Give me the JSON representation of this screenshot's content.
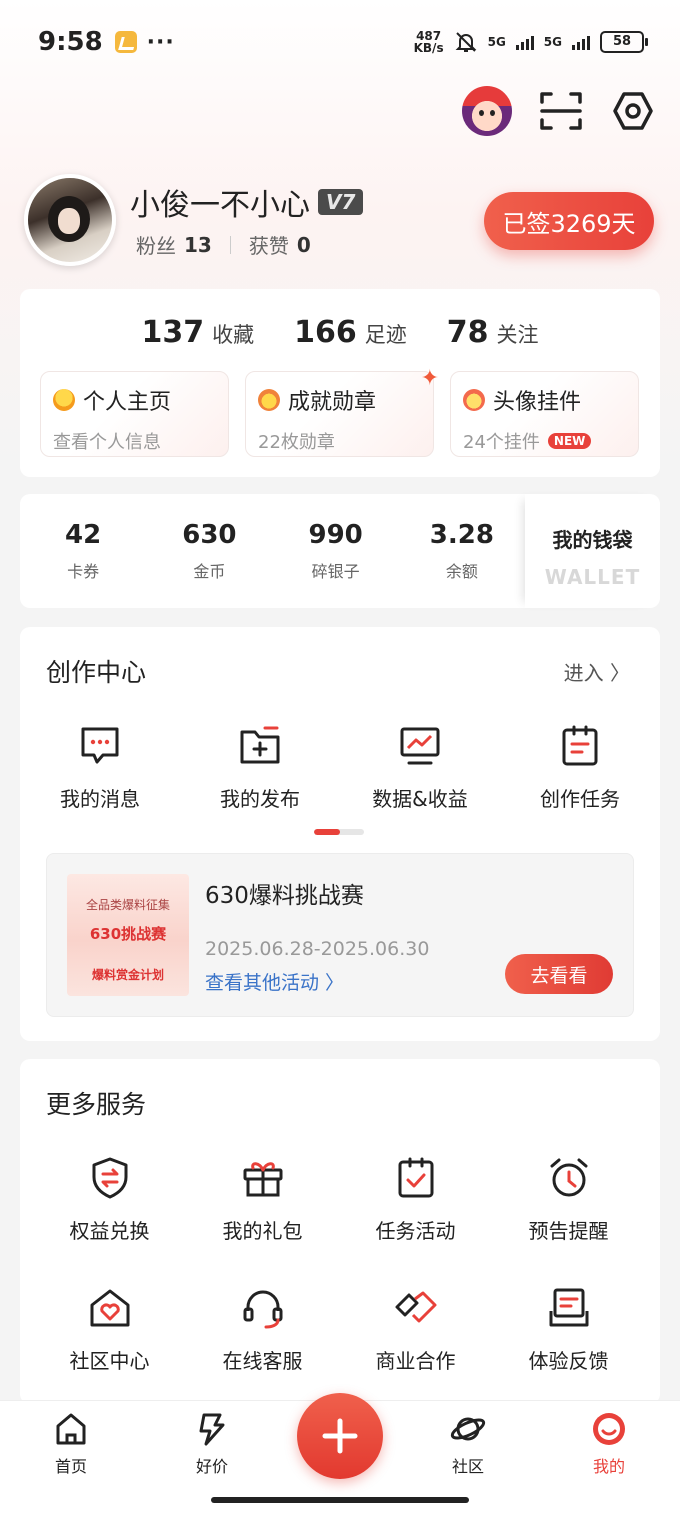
{
  "status_bar": {
    "time": "9:58",
    "dots": "···",
    "speed_num": "487",
    "speed_unit": "KB/s",
    "network1": "5G",
    "network2": "5G",
    "battery": "58"
  },
  "top_icons": [
    "mascot-avatar",
    "scan-icon",
    "settings-icon"
  ],
  "profile": {
    "username": "小俊一不小心",
    "level": "V7",
    "fans_label": "粉丝",
    "fans_count": "13",
    "likes_label": "获赞",
    "likes_count": "0",
    "signed_text": "已签3269天"
  },
  "stats": [
    {
      "num": "137",
      "label": "收藏"
    },
    {
      "num": "166",
      "label": "足迹"
    },
    {
      "num": "78",
      "label": "关注"
    }
  ],
  "tiles": [
    {
      "title": "个人主页",
      "sub": "查看个人信息"
    },
    {
      "title": "成就勋章",
      "sub": "22枚勋章"
    },
    {
      "title": "头像挂件",
      "sub": "24个挂件",
      "badge": "NEW"
    }
  ],
  "wallet": {
    "items": [
      {
        "num": "42",
        "label": "卡券"
      },
      {
        "num": "630",
        "label": "金币"
      },
      {
        "num": "990",
        "label": "碎银子"
      },
      {
        "num": "3.28",
        "label": "余额"
      }
    ],
    "title": "我的钱袋",
    "subtitle": "WALLET"
  },
  "creation": {
    "title": "创作中心",
    "enter": "进入 〉",
    "items": [
      {
        "label": "我的消息",
        "icon": "message-icon"
      },
      {
        "label": "我的发布",
        "icon": "publish-icon"
      },
      {
        "label": "数据&收益",
        "icon": "data-icon"
      },
      {
        "label": "创作任务",
        "icon": "task-icon"
      }
    ],
    "promo": {
      "img_line1": "全品类爆料征集",
      "img_line2": "630挑战赛",
      "img_line3": "爆料赏金计划",
      "title": "630爆料挑战赛",
      "date": "2025.06.28-2025.06.30",
      "link": "查看其他活动 〉",
      "button": "去看看"
    }
  },
  "services": {
    "title": "更多服务",
    "items": [
      {
        "label": "权益兑换",
        "icon": "exchange-shield-icon"
      },
      {
        "label": "我的礼包",
        "icon": "gift-icon"
      },
      {
        "label": "任务活动",
        "icon": "clipboard-check-icon"
      },
      {
        "label": "预告提醒",
        "icon": "alarm-clock-icon"
      },
      {
        "label": "社区中心",
        "icon": "community-heart-icon"
      },
      {
        "label": "在线客服",
        "icon": "headset-icon"
      },
      {
        "label": "商业合作",
        "icon": "handshake-icon"
      },
      {
        "label": "体验反馈",
        "icon": "feedback-icon"
      }
    ]
  },
  "bottom_nav": [
    {
      "label": "首页",
      "icon": "home-icon"
    },
    {
      "label": "好价",
      "icon": "deal-icon"
    },
    {
      "label": "社区",
      "icon": "planet-icon"
    },
    {
      "label": "我的",
      "icon": "me-icon",
      "active": true
    }
  ],
  "colors": {
    "accent": "#e8413a",
    "link": "#3a73c8",
    "background": "#f4f4f4"
  }
}
